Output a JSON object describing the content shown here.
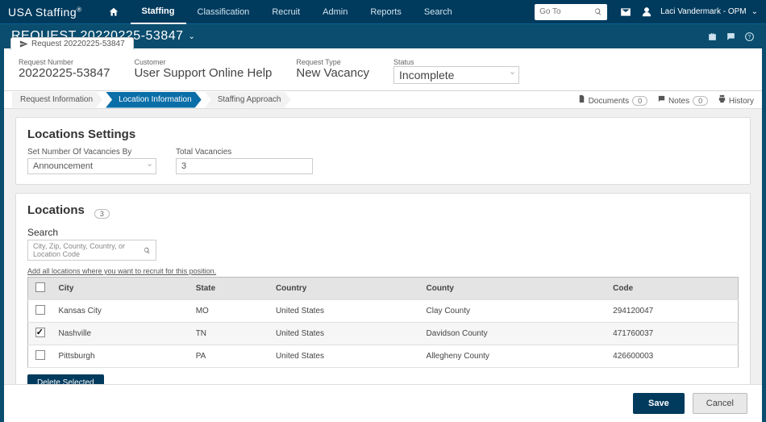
{
  "brand": "USA Staffing",
  "nav": [
    "Staffing",
    "Classification",
    "Recruit",
    "Admin",
    "Reports",
    "Search"
  ],
  "activeNav": 0,
  "goto_placeholder": "Go To",
  "user": "Laci Vandermark - OPM",
  "page_title": "REQUEST 20220225-53847",
  "tab_label": "Request 20220225-53847",
  "request": {
    "number_label": "Request Number",
    "number": "20220225-53847",
    "customer_label": "Customer",
    "customer": "User Support Online Help",
    "type_label": "Request Type",
    "type": "New Vacancy",
    "status_label": "Status",
    "status": "Incomplete"
  },
  "steps": [
    "Request Information",
    "Location Information",
    "Staffing Approach"
  ],
  "activeStep": 1,
  "tools": {
    "documents": "Documents",
    "documents_count": "0",
    "notes": "Notes",
    "notes_count": "0",
    "history": "History"
  },
  "loc_settings": {
    "title": "Locations Settings",
    "set_by_label": "Set Number Of Vacancies By",
    "set_by_value": "Announcement",
    "total_label": "Total Vacancies",
    "total_value": "3"
  },
  "locations": {
    "title": "Locations",
    "count": "3",
    "search_label": "Search",
    "search_placeholder": "City, Zip, County, Country, or Location Code",
    "hint": "Add all locations where you want to recruit for this position.",
    "cols": [
      "City",
      "State",
      "Country",
      "County",
      "Code"
    ],
    "rows": [
      {
        "checked": false,
        "city": "Kansas City",
        "state": "MO",
        "country": "United States",
        "county": "Clay County",
        "code": "294120047"
      },
      {
        "checked": true,
        "city": "Nashville",
        "state": "TN",
        "country": "United States",
        "county": "Davidson County",
        "code": "471760037"
      },
      {
        "checked": false,
        "city": "Pittsburgh",
        "state": "PA",
        "country": "United States",
        "county": "Allegheny County",
        "code": "426600003"
      }
    ],
    "delete_label": "Delete Selected"
  },
  "footer": {
    "save": "Save",
    "cancel": "Cancel"
  }
}
